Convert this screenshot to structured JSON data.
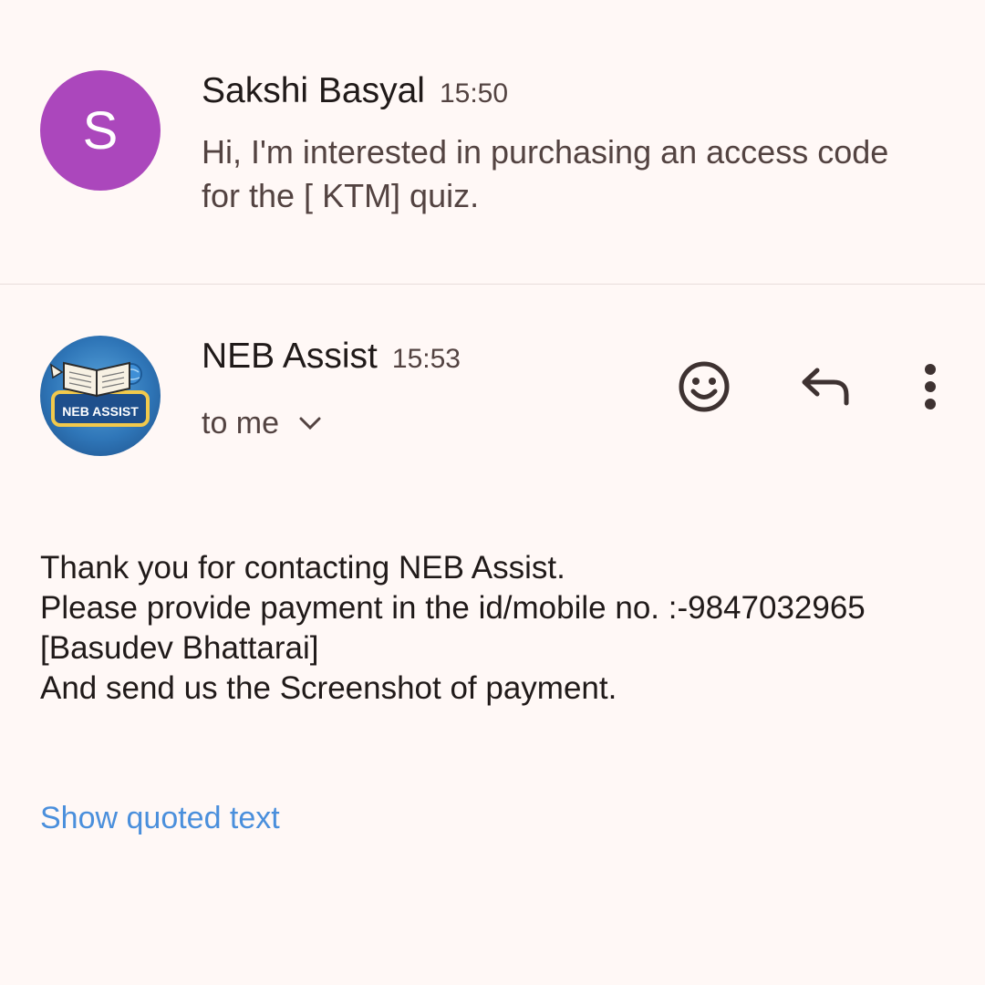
{
  "message1": {
    "avatar_letter": "S",
    "avatar_color": "#ab47bc",
    "sender": "Sakshi Basyal",
    "time": "15:50",
    "snippet": "Hi, I'm interested in purchasing an access code for the [ KTM] quiz."
  },
  "message2": {
    "avatar_logo_text": "NEB ASSIST",
    "sender": "NEB Assist",
    "time": "15:53",
    "recipient": "to me",
    "actions": [
      "emoji-icon",
      "reply-icon",
      "more-vert-icon"
    ],
    "body": [
      "Thank you for contacting NEB Assist.",
      "Please provide payment in the id/mobile no. :-9847032965",
      "[Basudev Bhattarai]",
      "And send us the Screenshot of payment."
    ],
    "show_quoted": "Show quoted text"
  },
  "colors": {
    "background": "#fff8f6",
    "link": "#4a8fdc",
    "primary_text": "#201a19",
    "secondary_text": "#534341"
  }
}
